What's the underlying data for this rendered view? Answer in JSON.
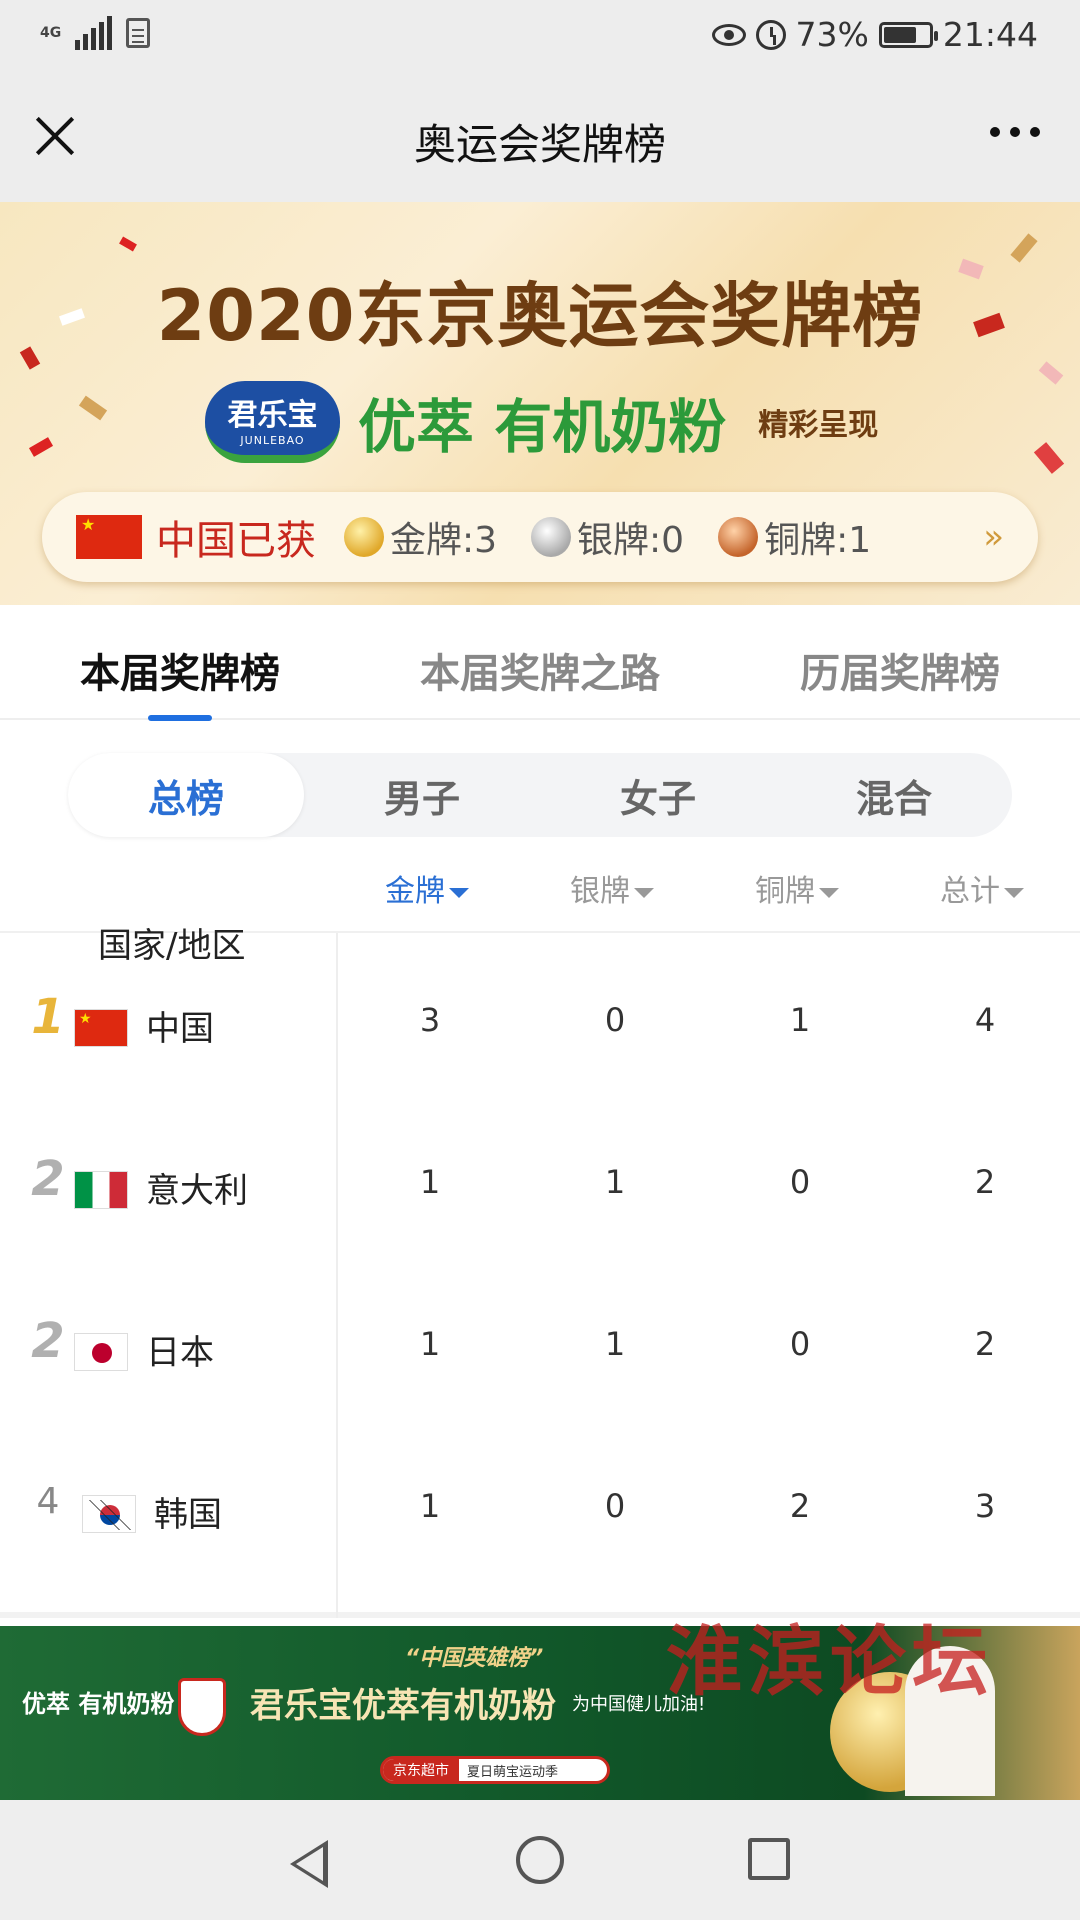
{
  "status_bar": {
    "network": "4G",
    "icons": [
      "signal-icon",
      "document-icon",
      "eye-icon",
      "alarm-icon",
      "battery-icon"
    ],
    "battery": "73%",
    "battery_level": 0.73,
    "time": "21:44"
  },
  "header": {
    "title": "奥运会奖牌榜",
    "close_icon": "close-icon",
    "more_icon": "more-icon"
  },
  "banner": {
    "title": "2020东京奥运会奖牌榜",
    "brand_logo": "君乐宝",
    "brand_logo_en": "JUNLEBAO",
    "brand_name": "优萃 有机奶粉",
    "brand_tag": "精彩呈现",
    "summary_label": "中国已获",
    "gold": "金牌:3",
    "silver": "银牌:0",
    "bronze": "铜牌:1",
    "arrow": "»"
  },
  "main_tabs": [
    {
      "label": "本届奖牌榜",
      "active": true
    },
    {
      "label": "本届奖牌之路",
      "active": false
    },
    {
      "label": "历届奖牌榜",
      "active": false
    }
  ],
  "sub_tabs": [
    {
      "label": "总榜",
      "active": true
    },
    {
      "label": "男子",
      "active": false
    },
    {
      "label": "女子",
      "active": false
    },
    {
      "label": "混合",
      "active": false
    }
  ],
  "columns": {
    "country": "国家/地区",
    "gold": "金牌",
    "silver": "银牌",
    "bronze": "铜牌",
    "total": "总计"
  },
  "rows": [
    {
      "rank": "1",
      "country": "中国",
      "flag": "cn-flag",
      "gold": "3",
      "silver": "0",
      "bronze": "1",
      "total": "4"
    },
    {
      "rank": "2",
      "country": "意大利",
      "flag": "it-flag",
      "gold": "1",
      "silver": "1",
      "bronze": "0",
      "total": "2"
    },
    {
      "rank": "2",
      "country": "日本",
      "flag": "jp-flag",
      "gold": "1",
      "silver": "1",
      "bronze": "0",
      "total": "2"
    },
    {
      "rank": "4",
      "country": "韩国",
      "flag": "kr-flag",
      "gold": "1",
      "silver": "0",
      "bronze": "2",
      "total": "3"
    }
  ],
  "ad": {
    "brand": "优萃 有机奶粉",
    "quote": "“中国英雄榜”",
    "main": "君乐宝优萃有机奶粉",
    "sub": "为中国健儿加油!",
    "shop": "京东超市",
    "search": "夏日萌宝运动季"
  },
  "watermark": "淮滨论坛",
  "colors": {
    "accent": "#2a6fd4",
    "banner_title": "#6e3d12",
    "brand_green": "#2c9a3a",
    "china_red": "#c8281e"
  }
}
